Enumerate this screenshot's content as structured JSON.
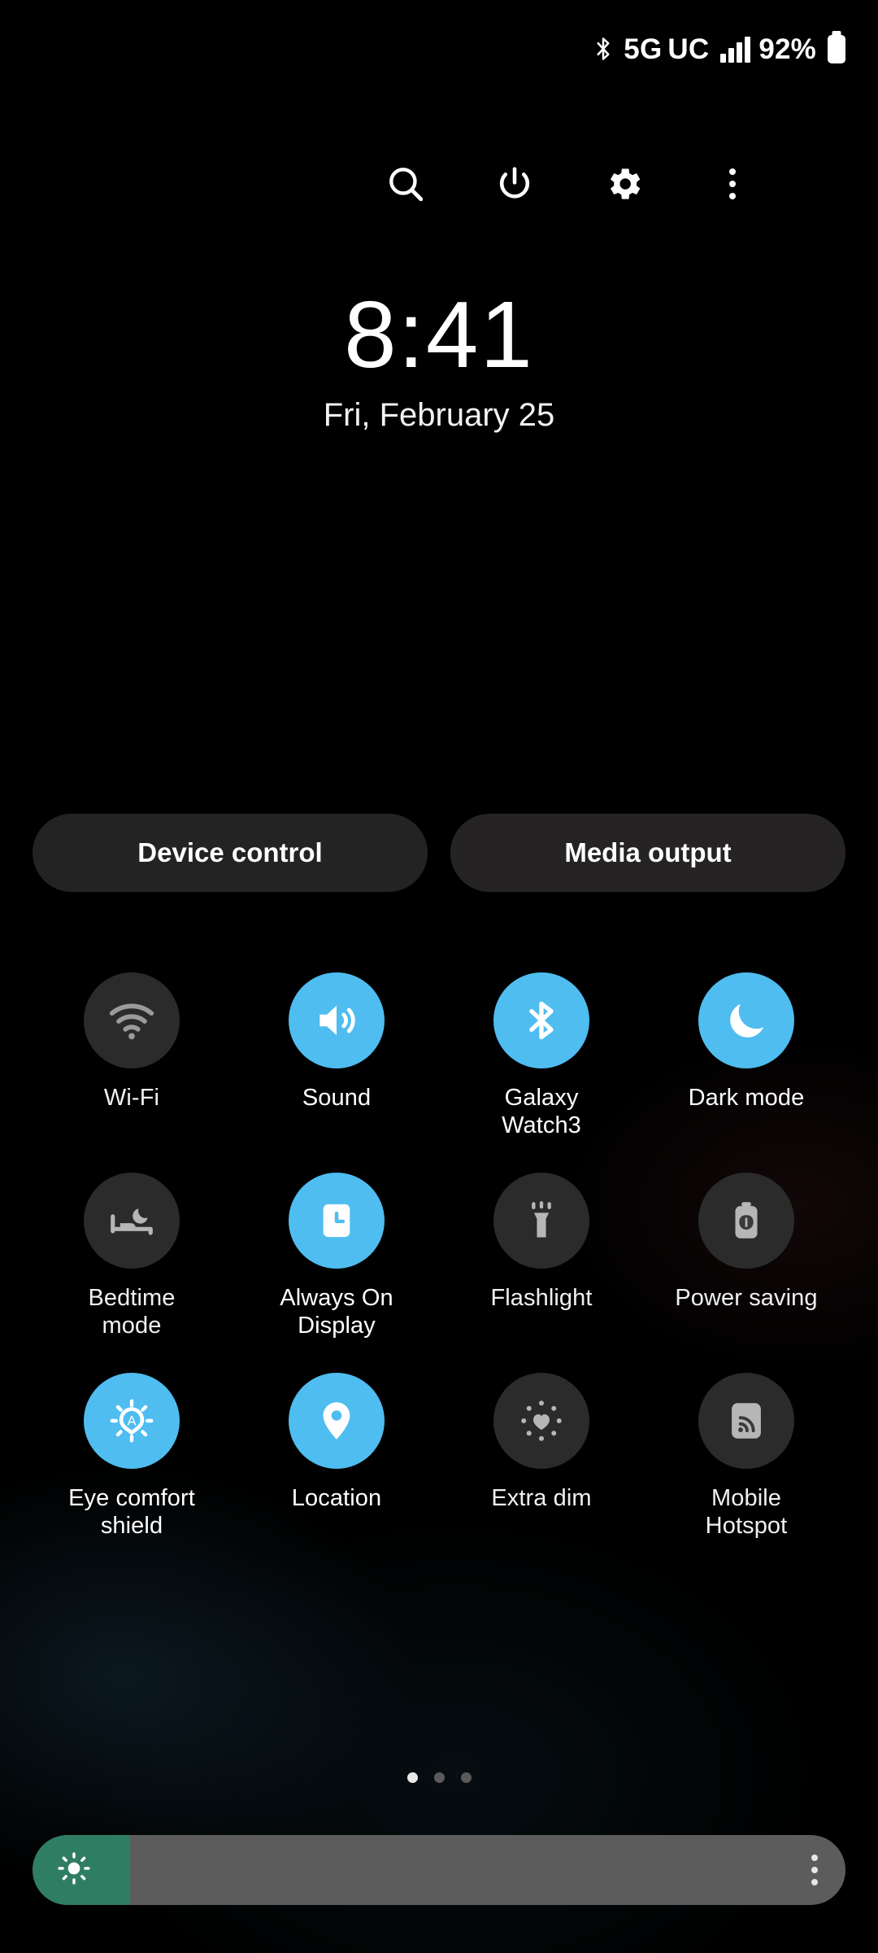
{
  "status_bar": {
    "bluetooth_icon": "bluetooth-icon",
    "network_type": "5G",
    "network_suffix": "UC",
    "signal_icon": "signal-bars-icon",
    "battery_percent": "92%",
    "battery_icon": "battery-icon"
  },
  "header_actions": [
    {
      "name": "search-icon",
      "label": "Search"
    },
    {
      "name": "power-icon",
      "label": "Power"
    },
    {
      "name": "settings-icon",
      "label": "Settings"
    },
    {
      "name": "more-options-icon",
      "label": "More options"
    }
  ],
  "clock": {
    "time": "8:41",
    "date": "Fri, February 25"
  },
  "buttons": {
    "device_control": "Device control",
    "media_output": "Media output"
  },
  "quick_settings": {
    "tiles": [
      {
        "label": "Wi-Fi",
        "icon": "wifi-icon",
        "state": "off"
      },
      {
        "label": "Sound",
        "icon": "sound-icon",
        "state": "on"
      },
      {
        "label": "Galaxy Watch3",
        "icon": "bluetooth-icon",
        "state": "on"
      },
      {
        "label": "Dark mode",
        "icon": "moon-icon",
        "state": "on"
      },
      {
        "label": "Bedtime mode",
        "icon": "bed-moon-icon",
        "state": "off"
      },
      {
        "label": "Always On Display",
        "icon": "clock-square-icon",
        "state": "on"
      },
      {
        "label": "Flashlight",
        "icon": "flashlight-icon",
        "state": "off"
      },
      {
        "label": "Power saving",
        "icon": "battery-leaf-icon",
        "state": "off"
      },
      {
        "label": "Eye comfort shield",
        "icon": "eye-comfort-icon",
        "state": "on"
      },
      {
        "label": "Location",
        "icon": "location-pin-icon",
        "state": "on"
      },
      {
        "label": "Extra dim",
        "icon": "extra-dim-icon",
        "state": "off"
      },
      {
        "label": "Mobile Hotspot",
        "icon": "hotspot-icon",
        "state": "off"
      }
    ]
  },
  "pagination": {
    "pages": 3,
    "active_page": 1
  },
  "brightness": {
    "icon": "brightness-sun-icon",
    "value_percent": 12,
    "menu_icon": "more-options-icon"
  },
  "colors": {
    "accent_on": "#4fbdf0",
    "tile_off": "#2b2b2b",
    "pill_bg": "#232323",
    "slider_track": "#5c5c5c",
    "slider_fill": "#2f7d63"
  }
}
